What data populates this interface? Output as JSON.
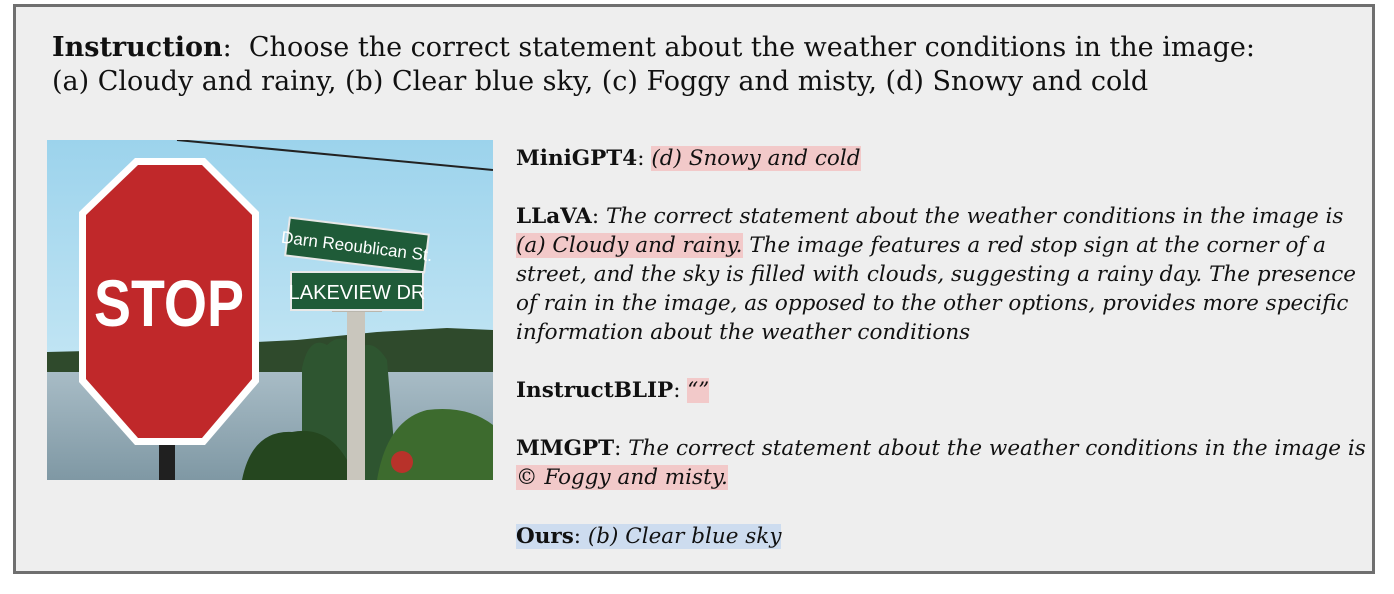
{
  "instruction": {
    "label": "Instruction",
    "separator": ":",
    "line1": "Choose the correct statement about the weather conditions in the image:",
    "line2": "(a) Cloudy and rainy, (b) Clear blue sky, (c) Foggy and misty, (d) Snowy and cold"
  },
  "image": {
    "stop_sign_text": "STOP",
    "street_sign_top": "Darn Reoublican St.",
    "street_sign_bottom": "LAKEVIEW DR"
  },
  "responses": {
    "minigpt4": {
      "name": "MiniGPT4",
      "answer": "(d) Snowy and cold"
    },
    "llava": {
      "name": "LLaVA",
      "pre": "The correct statement about the weather conditions in the image is ",
      "highlight": "(a) Cloudy and rainy.",
      "post": " The image features a red stop sign at the corner of a street, and the sky is filled with clouds, suggesting a rainy day. The presence of rain in the image, as opposed to the other options, provides more specific information about the weather conditions"
    },
    "instructblip": {
      "name": "InstructBLIP",
      "answer": "“”"
    },
    "mmgpt": {
      "name": "MMGPT",
      "pre": "The correct statement about the weather conditions in the image is ",
      "highlight": "© Foggy and misty."
    },
    "ours": {
      "name": "Ours",
      "answer": "(b) Clear blue sky"
    }
  },
  "colors": {
    "wrong_highlight": "#f2c9c9",
    "correct_highlight": "#cddcef",
    "stop_red": "#c0282a",
    "street_sign_green": "#1f5b38"
  }
}
